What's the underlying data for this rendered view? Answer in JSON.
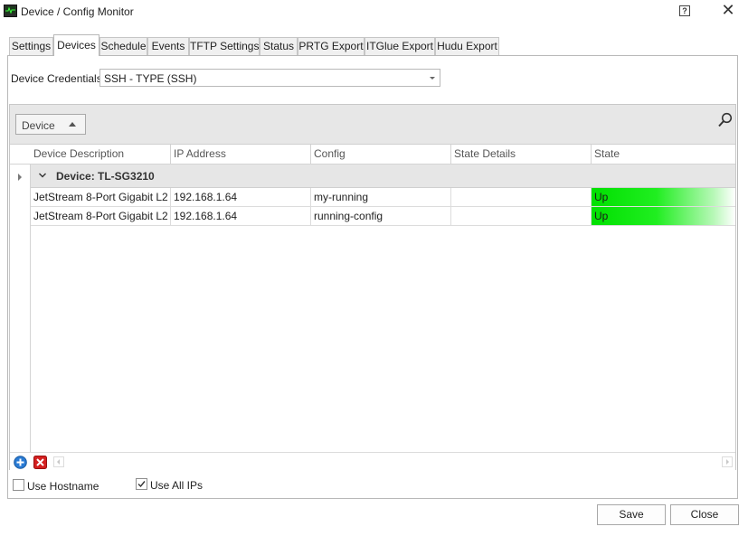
{
  "window": {
    "title": "Device / Config Monitor",
    "help_label": "?",
    "close_glyph": "✕"
  },
  "tabs": [
    {
      "label": "Settings"
    },
    {
      "label": "Devices",
      "active": true
    },
    {
      "label": "Schedule"
    },
    {
      "label": "Events"
    },
    {
      "label": "TFTP Settings"
    },
    {
      "label": "Status"
    },
    {
      "label": "PRTG Export"
    },
    {
      "label": "ITGlue Export"
    },
    {
      "label": "Hudu Export"
    }
  ],
  "credentials": {
    "label": "Device Credentials:",
    "value": "SSH - TYPE (SSH)"
  },
  "grid": {
    "group_chip": "Device",
    "columns": [
      "Device Description",
      "IP Address",
      "Config",
      "State Details",
      "State"
    ],
    "group_row": "Device: TL-SG3210",
    "rows": [
      {
        "description": "JetStream 8-Port Gigabit L2 ...",
        "ip": "192.168.1.64",
        "config": "my-running",
        "state_details": "",
        "state": "Up"
      },
      {
        "description": "JetStream 8-Port Gigabit L2 ...",
        "ip": "192.168.1.64",
        "config": "running-config",
        "state_details": "",
        "state": "Up"
      }
    ]
  },
  "options": {
    "use_hostname": {
      "label": "Use Hostname",
      "checked": false
    },
    "use_all_ips": {
      "label": "Use All IPs",
      "checked": true
    }
  },
  "buttons": {
    "save": "Save",
    "close": "Close"
  },
  "colors": {
    "state_up": "#00e000",
    "add_icon": "#2a7bd4",
    "delete_icon": "#d42020"
  }
}
